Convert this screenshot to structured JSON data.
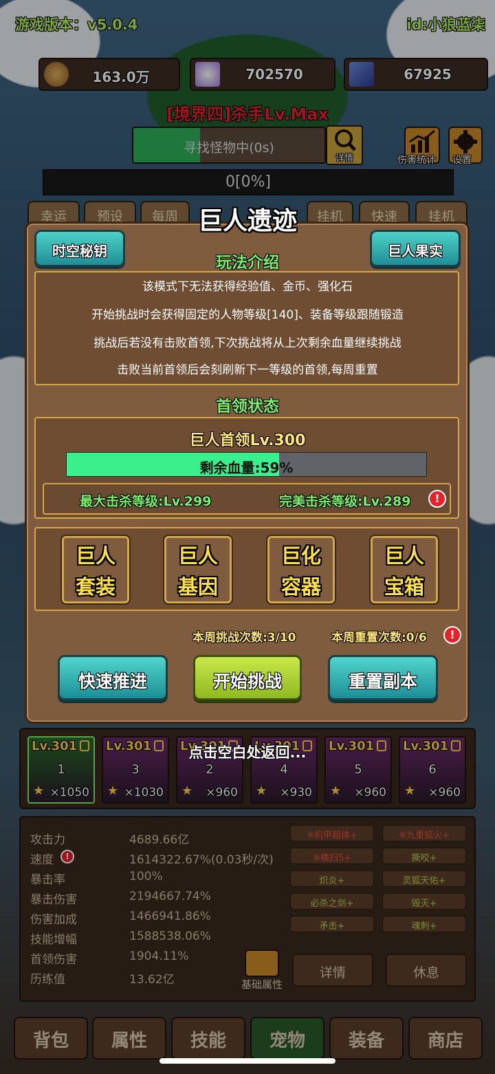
{
  "hud": {
    "version": "游戏版本：v5.0.4",
    "user_id": "id:小狼蓝柒",
    "gold": "163.0万",
    "crystal": "702570",
    "card": "67925",
    "realm": "[境界四]杀手Lv.Max",
    "search_status": "寻找怪物中(0s)",
    "search_progress": 0.35,
    "detail_label": "详情",
    "damage_stats_label": "伤害统计",
    "settings_label": "设置",
    "exp_text": "0[0%]",
    "behind_tabs": [
      "幸运",
      "预设",
      "每周",
      "挂机",
      "快速",
      "挂机"
    ]
  },
  "modal": {
    "title": "巨人遗迹",
    "left_button": "时空秘钥",
    "right_button": "巨人果实",
    "intro_heading": "玩法介绍",
    "intro_lines": [
      "该模式下无法获得经验值、金币、强化石",
      "开始挑战时会获得固定的人物等级[140]、装备等级跟随锻造",
      "挑战后若没有击败首领,下次挑战将从上次剩余血量继续挑战",
      "击败当前首领后会刻刷新下一等级的首领,每周重置"
    ],
    "boss_heading": "首领状态",
    "boss_name": "巨人首领Lv.300",
    "hp_text": "剩余血量:59%",
    "hp_percent": 59,
    "max_kill": "最大击杀等级:Lv.299",
    "perfect_kill": "完美击杀等级:Lv.289",
    "features": [
      {
        "line1": "巨人",
        "line2": "套装"
      },
      {
        "line1": "巨人",
        "line2": "基因"
      },
      {
        "line1": "巨化",
        "line2": "容器"
      },
      {
        "line1": "巨人",
        "line2": "宝箱"
      }
    ],
    "weekly_challenges": "本周挑战次数:3/10",
    "weekly_resets": "本周重置次数:0/6",
    "btn_fast": "快速推进",
    "btn_start": "开始挑战",
    "btn_reset": "重置副本"
  },
  "toast": "点击空白处返回...",
  "pets": [
    {
      "lv": "Lv.301",
      "num": "1",
      "count": "×1050",
      "color": "#2a6a2a"
    },
    {
      "lv": "Lv.301",
      "num": "3",
      "count": "×1030",
      "color": "#6a2a6a"
    },
    {
      "lv": "Lv.301",
      "num": "2",
      "count": "×960",
      "color": "#6a2a6a"
    },
    {
      "lv": "Lv.301",
      "num": "4",
      "count": "×930",
      "color": "#6a2a6a"
    },
    {
      "lv": "Lv.301",
      "num": "5",
      "count": "×960",
      "color": "#6a2a6a"
    },
    {
      "lv": "Lv.301",
      "num": "6",
      "count": "×960",
      "color": "#6a2a6a"
    }
  ],
  "stats": [
    {
      "name": "攻击力",
      "value": "4689.66亿"
    },
    {
      "name": "速度",
      "value": "1614322.67%(0.03秒/次)"
    },
    {
      "name": "暴击率",
      "value": "100%"
    },
    {
      "name": "暴击伤害",
      "value": "2194667.74%"
    },
    {
      "name": "伤害加成",
      "value": "1466941.86%"
    },
    {
      "name": "技能增幅",
      "value": "1588538.06%"
    },
    {
      "name": "首领伤害",
      "value": "1904.11%"
    },
    {
      "name": "历练值",
      "value": "13.62亿"
    }
  ],
  "skills": [
    {
      "label": "※机甲超体+",
      "red": true
    },
    {
      "label": "※九重狐火+",
      "red": true
    },
    {
      "label": "※横扫5+",
      "red": true
    },
    {
      "label": "撕咬+",
      "red": false
    },
    {
      "label": "炽炎+",
      "red": false
    },
    {
      "label": "灵狐天佑+",
      "red": false
    },
    {
      "label": "必杀之剑+",
      "red": false
    },
    {
      "label": "毁灭+",
      "red": false
    },
    {
      "label": "矛击+",
      "red": false
    },
    {
      "label": "魂刺+",
      "red": false
    }
  ],
  "base_attr_label": "基础属性",
  "detail_btn": "详情",
  "rest_btn": "休息",
  "bottom_tabs": [
    "背包",
    "属性",
    "技能",
    "宠物",
    "装备",
    "商店"
  ],
  "active_tab": 3,
  "colors": {
    "accent_green": "#7cf06c",
    "hp_green": "#3af08c",
    "gold_text": "#ffe04a",
    "realm_red": "#e8232a"
  }
}
